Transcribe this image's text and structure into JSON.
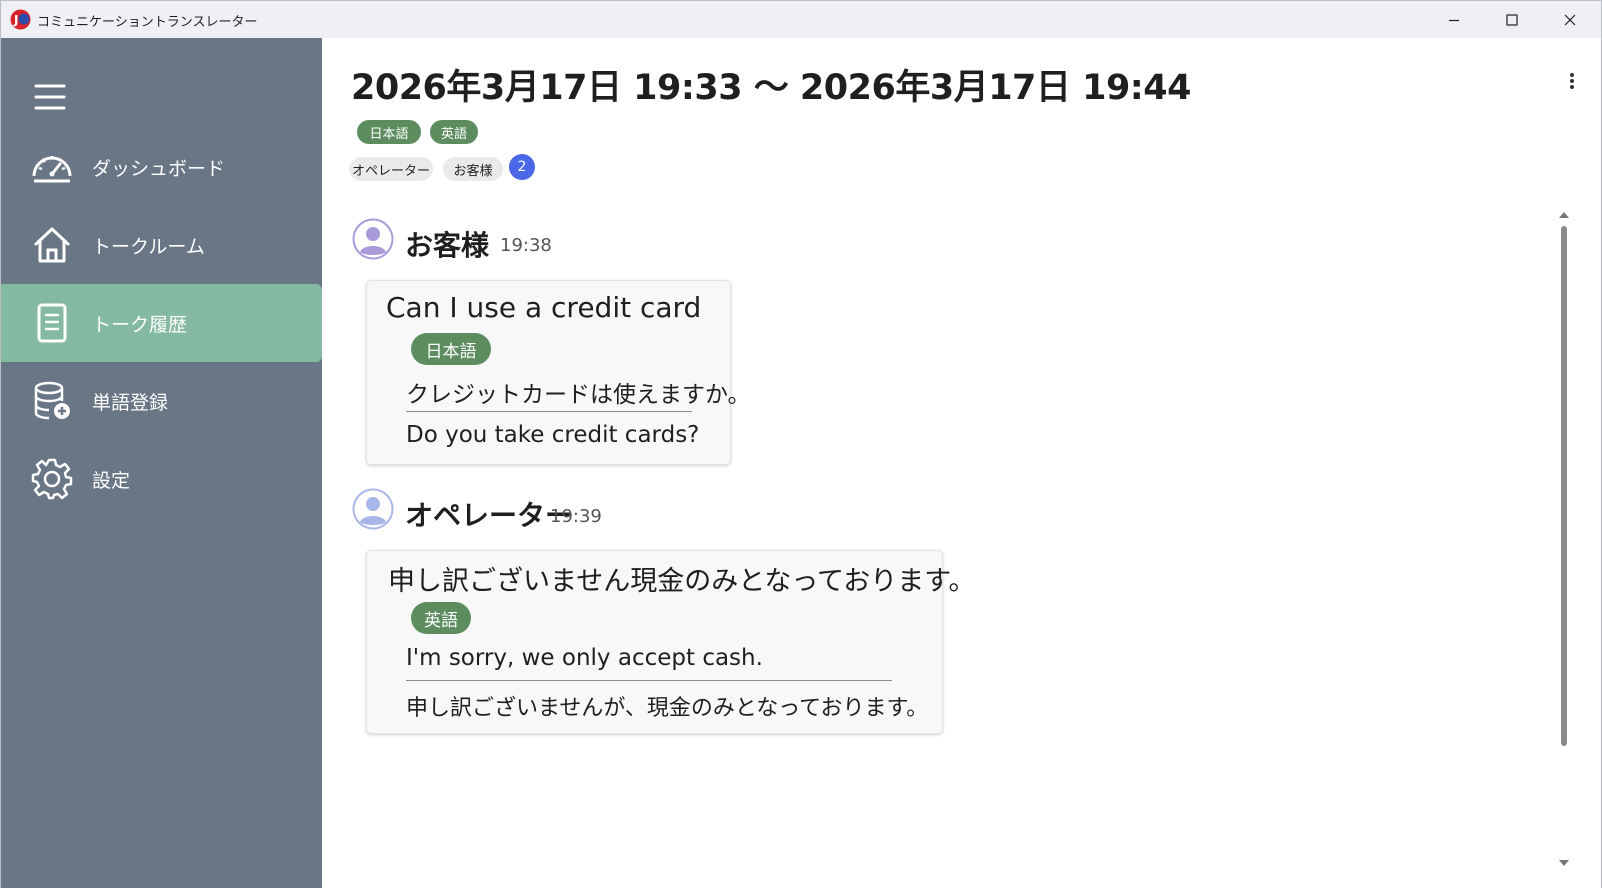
{
  "window": {
    "title": "コミュニケーショントランスレーター",
    "app_icon_letter": "J"
  },
  "sidebar": {
    "background": "#687686",
    "active_color": "#84b9a2",
    "menu_icon": "hamburger-icon",
    "items": [
      {
        "label": "ダッシュボード",
        "icon": "dashboard-gauge-icon",
        "active": false
      },
      {
        "label": "トークルーム",
        "icon": "home-icon",
        "active": false
      },
      {
        "label": "トーク履歴",
        "icon": "document-icon",
        "active": true
      },
      {
        "label": "単語登録",
        "icon": "database-add-icon",
        "active": false
      },
      {
        "label": "設定",
        "icon": "gear-icon",
        "active": false
      }
    ]
  },
  "main": {
    "title": "2026年3月17日 19:33 ～ 2026年3月17日 19:44",
    "language_tags": [
      "日本語",
      "英語"
    ],
    "participant_tags": [
      "オペレーター",
      "お客様"
    ],
    "participant_count": "2",
    "accent_green": "#5d8d5f",
    "badge_blue": "#4a67e8",
    "messages": [
      {
        "speaker": "お客様",
        "time": "19:38",
        "original": "Can I use a credit card",
        "target_language": "日本語",
        "translation": "クレジットカードは使えますか。",
        "back_translation": "Do you take credit cards?"
      },
      {
        "speaker": "オペレーター",
        "time": "19:39",
        "original": "申し訳ございません現金のみとなっております。",
        "target_language": "英語",
        "translation": "I'm sorry, we only accept cash.",
        "back_translation": "申し訳ございませんが、現金のみとなっております。"
      }
    ]
  }
}
